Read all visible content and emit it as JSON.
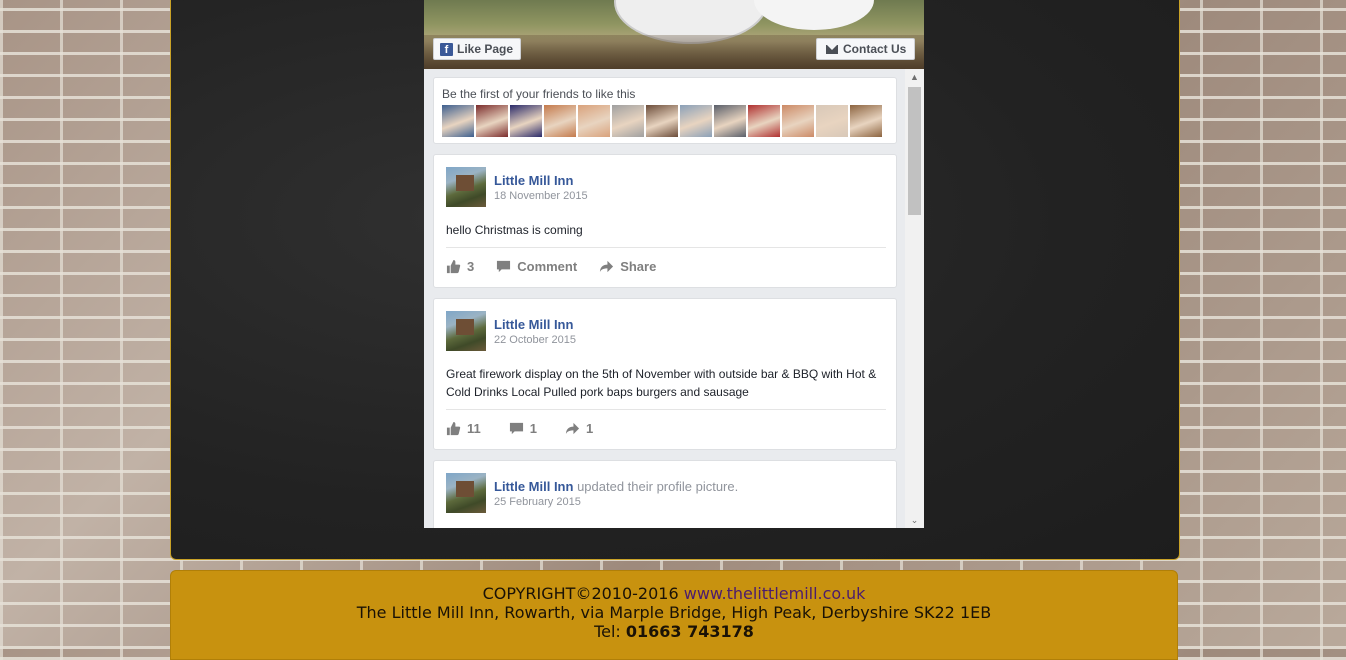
{
  "facebook_widget": {
    "like_page_label": "Like Page",
    "contact_label": "Contact Us",
    "friends_prompt": "Be the first of your friends to like this",
    "friend_avatar_colors": [
      "#3d5f8f",
      "#7b2c2c",
      "#2a2a6a",
      "#c47a4c",
      "#d9a27c",
      "#a0a0a0",
      "#6c4d3a",
      "#8aa0b8",
      "#5a5f6a",
      "#b03030",
      "#cc8a66",
      "#d8c8b8",
      "#8c6440"
    ],
    "posts": [
      {
        "author": "Little Mill Inn",
        "subtitle": "",
        "date": "18 November 2015",
        "text": "hello Christmas is coming",
        "likes": "3",
        "comment_label": "Comment",
        "share_label": "Share"
      },
      {
        "author": "Little Mill Inn",
        "subtitle": "",
        "date": "22 October 2015",
        "text": "Great firework display on the 5th of November with outside bar & BBQ with Hot & Cold Drinks Local Pulled pork baps burgers and sausage",
        "likes": "11",
        "comments": "1",
        "shares": "1"
      },
      {
        "author": "Little Mill Inn",
        "subtitle": "updated their profile picture.",
        "date": "25 February 2015"
      }
    ]
  },
  "footer": {
    "copyright": "COPYRIGHT©2010-2016",
    "website": "www.thelittlemill.co.uk",
    "address": "The Little Mill Inn, Rowarth, via Marple Bridge, High Peak, Derbyshire SK22 1EB",
    "tel_label": "Tel:",
    "tel_number": "01663 743178"
  },
  "colors": {
    "footer_bg": "#c8920f",
    "board_bg": "#262626",
    "facebook_link": "#365899",
    "website_link": "#4b1c6e"
  }
}
